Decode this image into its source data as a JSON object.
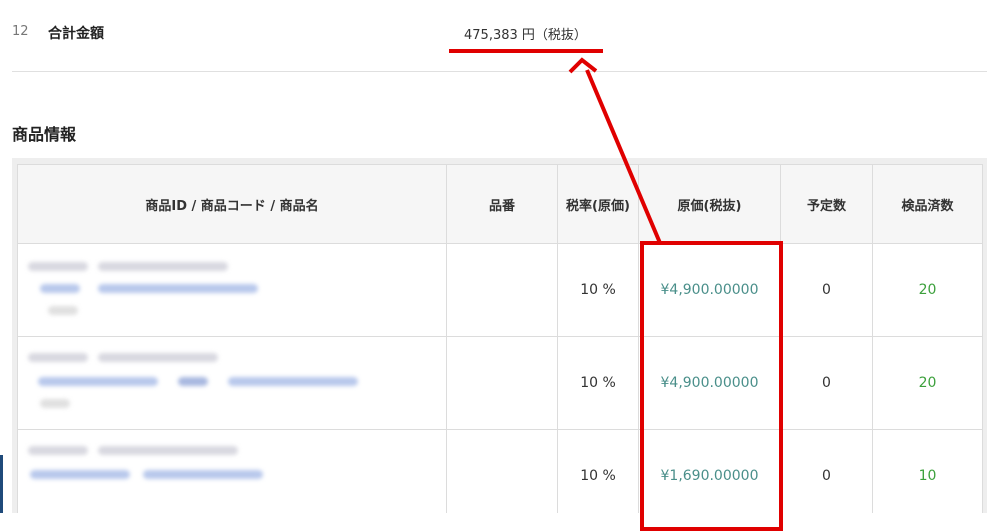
{
  "summary": {
    "row_number": "12",
    "label": "合計金額",
    "value": "475,383 円（税抜）"
  },
  "section": {
    "title": "商品情報"
  },
  "table": {
    "headers": {
      "product": "商品ID / 商品コード / 商品名",
      "part_no": "品番",
      "tax_rate": "税率(原価)",
      "cost": "原価(税抜)",
      "planned": "予定数",
      "inspected": "検品済数"
    },
    "rows": [
      {
        "tax_rate": "10 %",
        "cost": "¥4,900.00000",
        "planned": "0",
        "inspected": "20"
      },
      {
        "tax_rate": "10 %",
        "cost": "¥4,900.00000",
        "planned": "0",
        "inspected": "20"
      },
      {
        "tax_rate": "10 %",
        "cost": "¥1,690.00000",
        "planned": "0",
        "inspected": "10"
      }
    ]
  },
  "colors": {
    "annotation": "#e00000",
    "cost_text": "#4a8f8a",
    "inspected_text": "#3ca03c"
  }
}
